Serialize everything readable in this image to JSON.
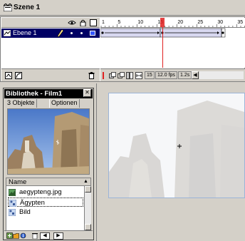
{
  "scene": {
    "label": "Szene 1",
    "icon": "scene-icon"
  },
  "timeline": {
    "header_icons": [
      "eye-icon",
      "lock-icon",
      "outline-icon"
    ],
    "layer": {
      "name": "Ebene 1",
      "icon": "layer-icon",
      "pencil_icon": "pencil-icon",
      "color": "#3355ff"
    },
    "ruler_ticks": [
      "1",
      "5",
      "10",
      "15",
      "20",
      "25",
      "30",
      "35"
    ],
    "playhead_frame": 15,
    "footer_icons": [
      "add-layer-icon",
      "add-guide-layer-icon",
      "trash-icon"
    ],
    "status": {
      "icons": [
        "center-frame-icon",
        "onion-skin-icon",
        "onion-skin-outlines-icon",
        "edit-multiple-frames-icon",
        "modify-onion-markers-icon"
      ],
      "current_frame": "15",
      "frame_rate": "12.0 fps",
      "elapsed": "1.2s"
    },
    "playhead_color": "#e02020"
  },
  "library": {
    "title": "Bibliothek - Film1",
    "close_label": "✕",
    "count_label": "3 Objekte",
    "options_label": "Optionen",
    "name_header": "Name",
    "items": [
      {
        "name": "aegypteng.jpg",
        "icon": "bitmap-icon"
      },
      {
        "name": "Ägypten",
        "icon": "graphic-symbol-icon"
      },
      {
        "name": "Bild",
        "icon": "graphic-symbol-icon"
      }
    ],
    "footer_icons": [
      "new-symbol-icon",
      "new-folder-icon",
      "properties-icon",
      "delete-icon"
    ]
  },
  "stage": {
    "border_color": "#9bb4d8",
    "background": "#ffffff"
  }
}
